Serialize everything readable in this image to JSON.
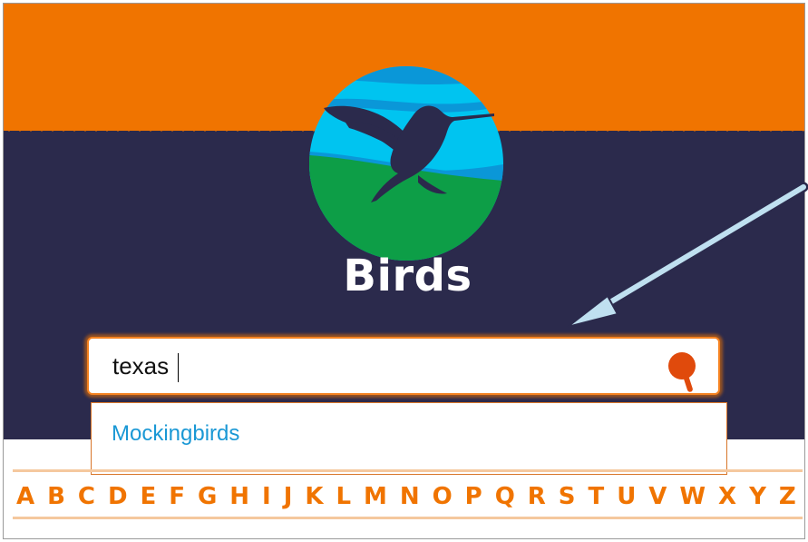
{
  "header": {
    "title": "Birds",
    "logo_icon": "hummingbird-logo-icon"
  },
  "search": {
    "value": "texas",
    "icon": "search-icon",
    "suggestions": [
      "Mockingbirds"
    ]
  },
  "alphabet": [
    "A",
    "B",
    "C",
    "D",
    "E",
    "F",
    "G",
    "H",
    "I",
    "J",
    "K",
    "L",
    "M",
    "N",
    "O",
    "P",
    "Q",
    "R",
    "S",
    "T",
    "U",
    "V",
    "W",
    "X",
    "Y",
    "Z"
  ],
  "annotation": {
    "icon": "arrow-icon",
    "color": "#bfe0f0"
  },
  "colors": {
    "orange": "#f07400",
    "navy": "#2b2a4c",
    "link_blue": "#1a98d5"
  }
}
